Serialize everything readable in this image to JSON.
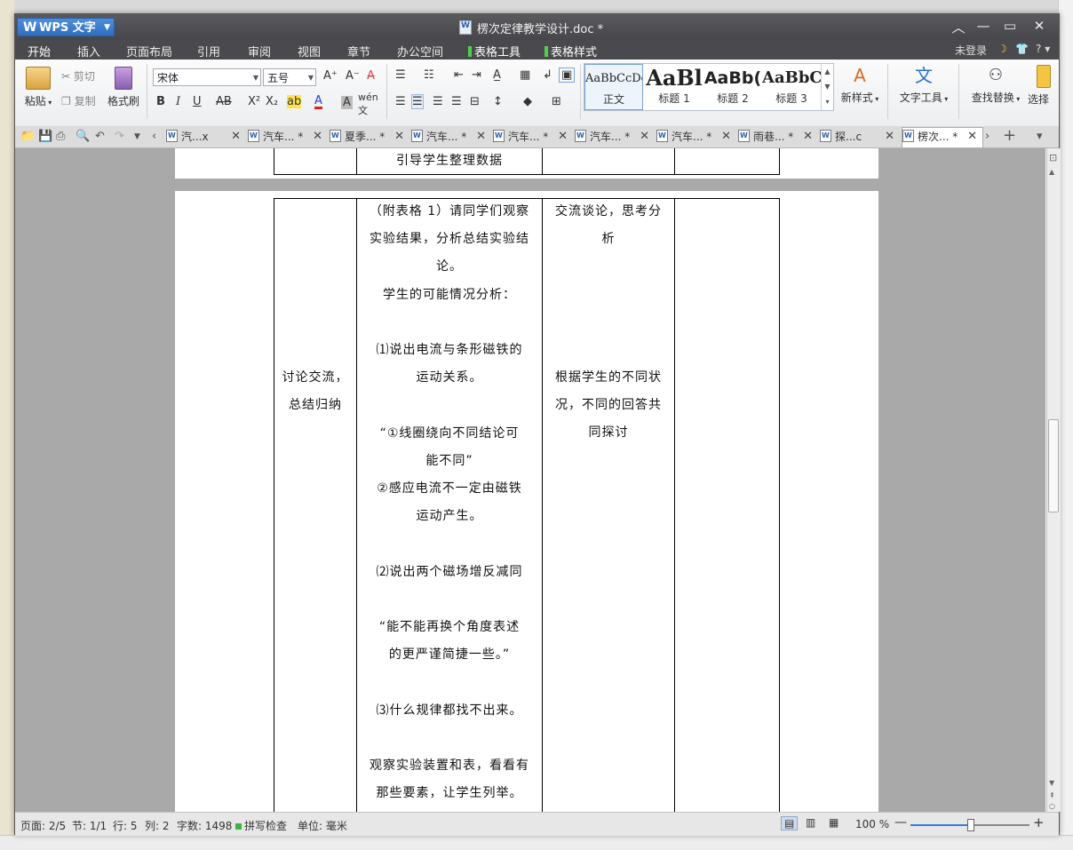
{
  "window": {
    "app_name": "WPS 文字",
    "app_logo": "W",
    "doc_title": "楞次定律教学设计.doc *"
  },
  "menu": {
    "items": [
      "开始",
      "插入",
      "页面布局",
      "引用",
      "审阅",
      "视图",
      "章节",
      "办公空间"
    ],
    "table_tools": [
      "表格工具",
      "表格样式"
    ],
    "login": "未登录",
    "help": "?"
  },
  "ribbon": {
    "paste": "粘贴",
    "cut": "剪切",
    "copy": "复制",
    "format_painter": "格式刷",
    "font_name": "宋体",
    "font_size": "五号",
    "styles": [
      {
        "preview": "AaBbCcDc",
        "name": "正文"
      },
      {
        "preview": "AaBl",
        "name": "标题 1"
      },
      {
        "preview": "AaBb(",
        "name": "标题 2"
      },
      {
        "preview": "AaBbC",
        "name": "标题 3"
      }
    ],
    "new_style": "新样式",
    "text_tools": "文字工具",
    "find_replace": "查找替换",
    "select": "选择"
  },
  "tabs": [
    {
      "label": "汽...x"
    },
    {
      "label": "汽车... *"
    },
    {
      "label": "夏季... *"
    },
    {
      "label": "汽车... *"
    },
    {
      "label": "汽车... *"
    },
    {
      "label": "汽车... *"
    },
    {
      "label": "汽车... *"
    },
    {
      "label": "雨巷... *"
    },
    {
      "label": "探...c"
    },
    {
      "label": "楞次... *"
    }
  ],
  "document": {
    "top_row_text": "引导学生整理数据",
    "col1_lines": [
      "讨论交流，",
      "总结归纳"
    ],
    "col2_lines": [
      "（附表格 1）请同学们观察",
      "实验结果，分析总结实验结",
      "论。",
      "学生的可能情况分析：",
      "",
      "⑴说出电流与条形磁铁的",
      "运动关系。",
      "",
      "“①线圈绕向不同结论可",
      "能不同”",
      "②感应电流不一定由磁铁",
      "运动产生。",
      "",
      "⑵说出两个磁场增反减同",
      "",
      "“能不能再换个角度表述",
      "的更严谨简捷一些。”",
      "",
      "⑶什么规律都找不出来。",
      "",
      "观察实验装置和表，看看有",
      "那些要素，让学生列举。"
    ],
    "col3_lines_a": [
      "交流谈论，思考分",
      "析"
    ],
    "col3_lines_b": [
      "根据学生的不同状",
      "况，不同的回答共",
      "同探讨"
    ]
  },
  "status": {
    "page": "页面: 2/5",
    "section": "节: 1/1",
    "row": "行: 5",
    "col": "列: 2",
    "words": "字数: 1498",
    "spell": "拼写检查",
    "unit": "单位: 毫米",
    "zoom": "100 %",
    "zoom_fraction": 0.5
  }
}
